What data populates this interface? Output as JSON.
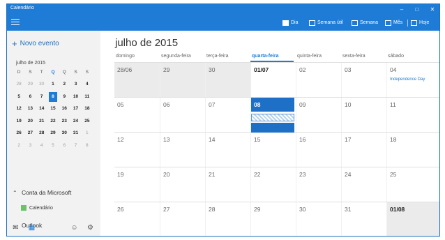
{
  "app": {
    "title": "Calendário"
  },
  "window_controls": {
    "minimize": "–",
    "maximize": "□",
    "close": "✕"
  },
  "toolbar": {
    "day": "Dia",
    "workweek": "Semana útil",
    "week": "Semana",
    "month": "Mês",
    "today": "Hoje"
  },
  "sidebar": {
    "new_event": "Novo evento",
    "mini_calendar": {
      "title": "julho de 2015",
      "weekdays": [
        "D",
        "S",
        "T",
        "Q",
        "Q",
        "S",
        "S"
      ],
      "weeks": [
        [
          "28",
          "29",
          "30",
          "1",
          "2",
          "3",
          "4"
        ],
        [
          "5",
          "6",
          "7",
          "8",
          "9",
          "10",
          "11"
        ],
        [
          "12",
          "13",
          "14",
          "15",
          "16",
          "17",
          "18"
        ],
        [
          "19",
          "20",
          "21",
          "22",
          "23",
          "24",
          "25"
        ],
        [
          "26",
          "27",
          "28",
          "29",
          "30",
          "31",
          "1"
        ],
        [
          "2",
          "3",
          "4",
          "5",
          "6",
          "7",
          "8"
        ]
      ]
    },
    "account_header": "Conta da Microsoft",
    "calendar_item": "Calendário",
    "calendar_color": "#6bc26b",
    "outlook_header": "Outlook"
  },
  "main": {
    "month_title": "julho de 2015",
    "weekdays": [
      "domingo",
      "segunda-feira",
      "terça-feira",
      "quarta-feira",
      "quinta-feira",
      "sexta-feira",
      "sábado"
    ],
    "weeks": [
      [
        "28/06",
        "29",
        "30",
        "01/07",
        "02",
        "03",
        "04"
      ],
      [
        "05",
        "06",
        "07",
        "08",
        "09",
        "10",
        "11"
      ],
      [
        "12",
        "13",
        "14",
        "15",
        "16",
        "17",
        "18"
      ],
      [
        "19",
        "20",
        "21",
        "22",
        "23",
        "24",
        "25"
      ],
      [
        "26",
        "27",
        "28",
        "29",
        "30",
        "31",
        "01/08"
      ]
    ],
    "holiday": "Independence Day"
  },
  "colors": {
    "accent": "#1e7cd6",
    "today_cell": "#1e6fc6",
    "out_of_month": "#ebebeb"
  }
}
